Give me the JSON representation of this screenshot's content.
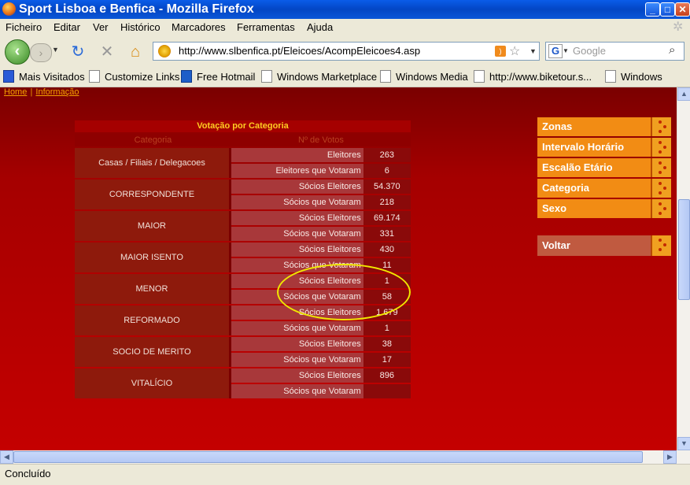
{
  "window": {
    "title": "Sport Lisboa e Benfica - Mozilla Firefox"
  },
  "menu": [
    "Ficheiro",
    "Editar",
    "Ver",
    "Histórico",
    "Marcadores",
    "Ferramentas",
    "Ajuda"
  ],
  "address": {
    "url": "http://www.slbenfica.pt/Eleicoes/AcompEleicoes4.asp"
  },
  "search": {
    "placeholder": "Google"
  },
  "bookmarks": [
    "Mais Visitados",
    "Customize Links",
    "Free Hotmail",
    "Windows Marketplace",
    "Windows Media",
    "http://www.biketour.s...",
    "Windows"
  ],
  "breadcrumb": {
    "home": "Home",
    "info": "Informação"
  },
  "table": {
    "title": "Votação por Categoria",
    "col_category": "Categoria",
    "col_votes": "Nº de Votos",
    "rows": [
      {
        "category": "Casas / Filiais / Delegacoes",
        "label1": "Eleitores",
        "value1": "263",
        "label2": "Eleitores que Votaram",
        "value2": "6"
      },
      {
        "category": "CORRESPONDENTE",
        "label1": "Sócios Eleitores",
        "value1": "54.370",
        "label2": "Sócios que Votaram",
        "value2": "218"
      },
      {
        "category": "MAIOR",
        "label1": "Sócios Eleitores",
        "value1": "69.174",
        "label2": "Sócios que Votaram",
        "value2": "331"
      },
      {
        "category": "MAIOR ISENTO",
        "label1": "Sócios Eleitores",
        "value1": "430",
        "label2": "Sócios que Votaram",
        "value2": "11"
      },
      {
        "category": "MENOR",
        "label1": "Sócios Eleitores",
        "value1": "1",
        "label2": "Sócios que Votaram",
        "value2": "58"
      },
      {
        "category": "REFORMADO",
        "label1": "Sócios Eleitores",
        "value1": "1.679",
        "label2": "Sócios que Votaram",
        "value2": "1"
      },
      {
        "category": "SOCIO DE MERITO",
        "label1": "Sócios Eleitores",
        "value1": "38",
        "label2": "Sócios que Votaram",
        "value2": "17"
      },
      {
        "category": "VITALÍCIO",
        "label1": "Sócios Eleitores",
        "value1": "896",
        "label2": "Sócios que Votaram",
        "value2": ""
      }
    ]
  },
  "side_menu": [
    "Zonas",
    "Intervalo Horário",
    "Escalão Etário",
    "Categoria",
    "Sexo"
  ],
  "voltar": "Voltar",
  "status": "Concluído"
}
